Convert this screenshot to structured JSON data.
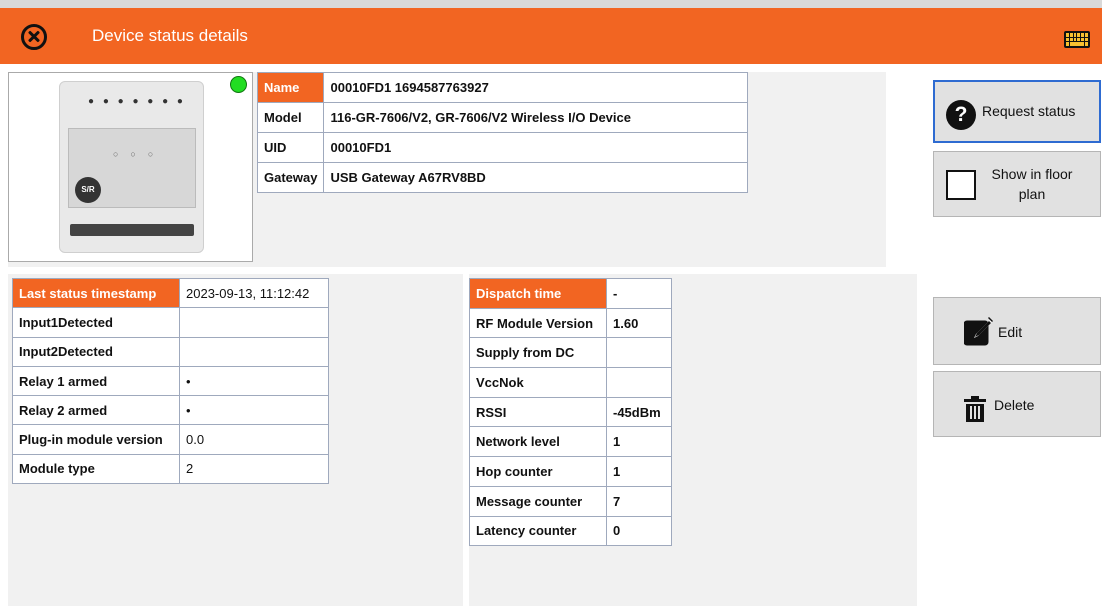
{
  "header": {
    "title": "Device status details",
    "close_icon": "close-circle-icon",
    "keyboard_icon": "keyboard-icon"
  },
  "device_image": {
    "status_color": "#22dd22"
  },
  "device_info": [
    {
      "key": "Name",
      "value": "00010FD1 1694587763927"
    },
    {
      "key": "Model",
      "value": "116-GR-7606/V2, GR-7606/V2 Wireless I/O Device"
    },
    {
      "key": "UID",
      "value": "00010FD1"
    },
    {
      "key": "Gateway",
      "value": "USB Gateway A67RV8BD"
    }
  ],
  "status_table": [
    {
      "key": "Last status timestamp",
      "value": "2023-09-13, 11:12:42"
    },
    {
      "key": "Input1Detected",
      "value": ""
    },
    {
      "key": "Input2Detected",
      "value": ""
    },
    {
      "key": "Relay 1 armed",
      "value": "•"
    },
    {
      "key": "Relay 2 armed",
      "value": "•"
    },
    {
      "key": "Plug-in module version",
      "value": "0.0"
    },
    {
      "key": "Module type",
      "value": "2"
    }
  ],
  "radio_table": [
    {
      "key": "Dispatch time",
      "value": "-"
    },
    {
      "key": "RF Module Version",
      "value": "1.60"
    },
    {
      "key": "Supply from DC",
      "value": ""
    },
    {
      "key": "VccNok",
      "value": ""
    },
    {
      "key": "RSSI",
      "value": "-45dBm"
    },
    {
      "key": "Network level",
      "value": "1"
    },
    {
      "key": "Hop counter",
      "value": "1"
    },
    {
      "key": "Message counter",
      "value": "7"
    },
    {
      "key": "Latency counter",
      "value": "0"
    }
  ],
  "actions": {
    "request_status": "Request status",
    "floor_plan_line1": "Show in floor",
    "floor_plan_line2": "plan",
    "edit": "Edit",
    "delete": "Delete"
  },
  "colors": {
    "accent": "#f26522",
    "panel": "#f1f1f1",
    "button": "#e1e1e1",
    "focus": "#2e6bd1"
  }
}
